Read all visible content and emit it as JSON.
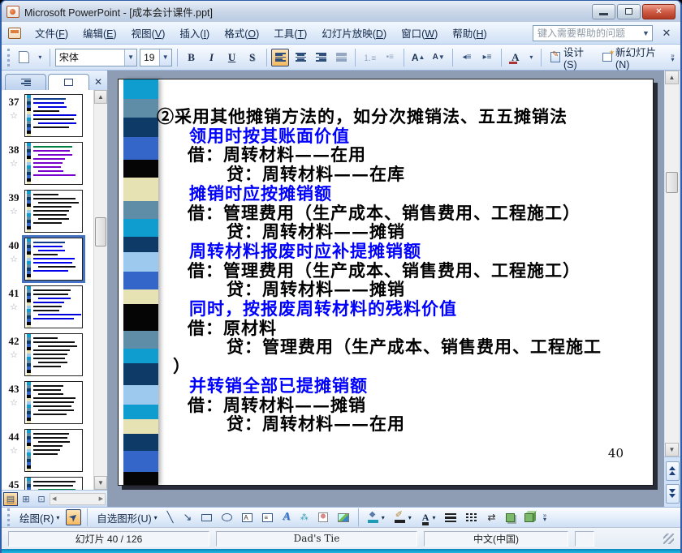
{
  "window": {
    "title": "Microsoft PowerPoint - [成本会计课件.ppt]"
  },
  "menu": {
    "items": [
      {
        "label": "文件",
        "key": "F"
      },
      {
        "label": "编辑",
        "key": "E"
      },
      {
        "label": "视图",
        "key": "V"
      },
      {
        "label": "插入",
        "key": "I"
      },
      {
        "label": "格式",
        "key": "O"
      },
      {
        "label": "工具",
        "key": "T"
      },
      {
        "label": "幻灯片放映",
        "key": "D"
      },
      {
        "label": "窗口",
        "key": "W"
      },
      {
        "label": "帮助",
        "key": "H"
      }
    ],
    "help_placeholder": "键入需要帮助的问题"
  },
  "toolbar": {
    "font_name": "宋体",
    "font_size": "19",
    "bold": "B",
    "italic": "I",
    "underline": "U",
    "shadow": "S",
    "design_label": "设计(S)",
    "new_slide_label": "新幻灯片(N)"
  },
  "sidebar": {
    "thumbnails": [
      {
        "num": "37",
        "theme": "blue",
        "selected": false
      },
      {
        "num": "38",
        "theme": "purple",
        "selected": false
      },
      {
        "num": "39",
        "theme": "dark",
        "selected": false
      },
      {
        "num": "40",
        "theme": "blue40",
        "selected": true
      },
      {
        "num": "41",
        "theme": "mixed",
        "selected": false
      },
      {
        "num": "42",
        "theme": "dark",
        "selected": false
      },
      {
        "num": "43",
        "theme": "dark",
        "selected": false
      },
      {
        "num": "44",
        "theme": "darkshort",
        "selected": false
      },
      {
        "num": "45",
        "theme": "mixed45",
        "selected": false
      }
    ]
  },
  "slide": {
    "number": "40",
    "lines": [
      {
        "text": "②采用其他摊销方法的，如分次摊销法、五五摊销法",
        "color": "black",
        "role": "title"
      },
      {
        "text": "领用时按其账面价值",
        "color": "blue",
        "role": "header"
      },
      {
        "text": "借：周转材料——在用",
        "color": "black",
        "role": "debit"
      },
      {
        "text": "贷：周转材料——在库",
        "color": "black",
        "role": "credit"
      },
      {
        "text": "摊销时应按摊销额",
        "color": "blue",
        "role": "header"
      },
      {
        "text": "借：管理费用（生产成本、销售费用、工程施工）",
        "color": "black",
        "role": "debit"
      },
      {
        "text": "贷：周转材料——摊销",
        "color": "black",
        "role": "credit"
      },
      {
        "text": "周转材料报废时应补提摊销额",
        "color": "blue",
        "role": "header"
      },
      {
        "text": "借：管理费用（生产成本、销售费用、工程施工）",
        "color": "black",
        "role": "debit"
      },
      {
        "text": "贷：周转材料——摊销",
        "color": "black",
        "role": "credit"
      },
      {
        "text": "同时，按报废周转材料的残料价值",
        "color": "blue",
        "role": "header"
      },
      {
        "text": "借：原材料",
        "color": "black",
        "role": "debit"
      },
      {
        "text": "贷：管理费用（生产成本、销售费用、工程施工",
        "color": "black",
        "role": "credit"
      },
      {
        "text": "）",
        "color": "black",
        "role": "close"
      },
      {
        "text": "并转销全部已提摊销额",
        "color": "blue",
        "role": "header"
      },
      {
        "text": "借：周转材料——摊销",
        "color": "black",
        "role": "debit"
      },
      {
        "text": "贷：周转材料——在用",
        "color": "black",
        "role": "credit"
      }
    ],
    "ribbon_palette": {
      "cyan": "#0f9dd0",
      "steel": "#5f8ca6",
      "navy": "#0d3a66",
      "royal": "#3465c8",
      "black": "#050505",
      "cream": "#e6e2b4",
      "light": "#9ec9ef"
    }
  },
  "drawing_toolbar": {
    "draw_label": "绘图(R)",
    "autoshapes_label": "自选图形(U)"
  },
  "status_bar": {
    "slide_indicator": "幻灯片 40 / 126",
    "design_template": "Dad's Tie",
    "language": "中文(中国)"
  },
  "colors": {
    "selection_highlight": "#f6b95e",
    "slide_blue_text": "#0000fe",
    "thumbnail_selection_border": "#4672c4",
    "editor_background": "#8e9db4",
    "window_bottom_edge": "#27c4ea"
  }
}
